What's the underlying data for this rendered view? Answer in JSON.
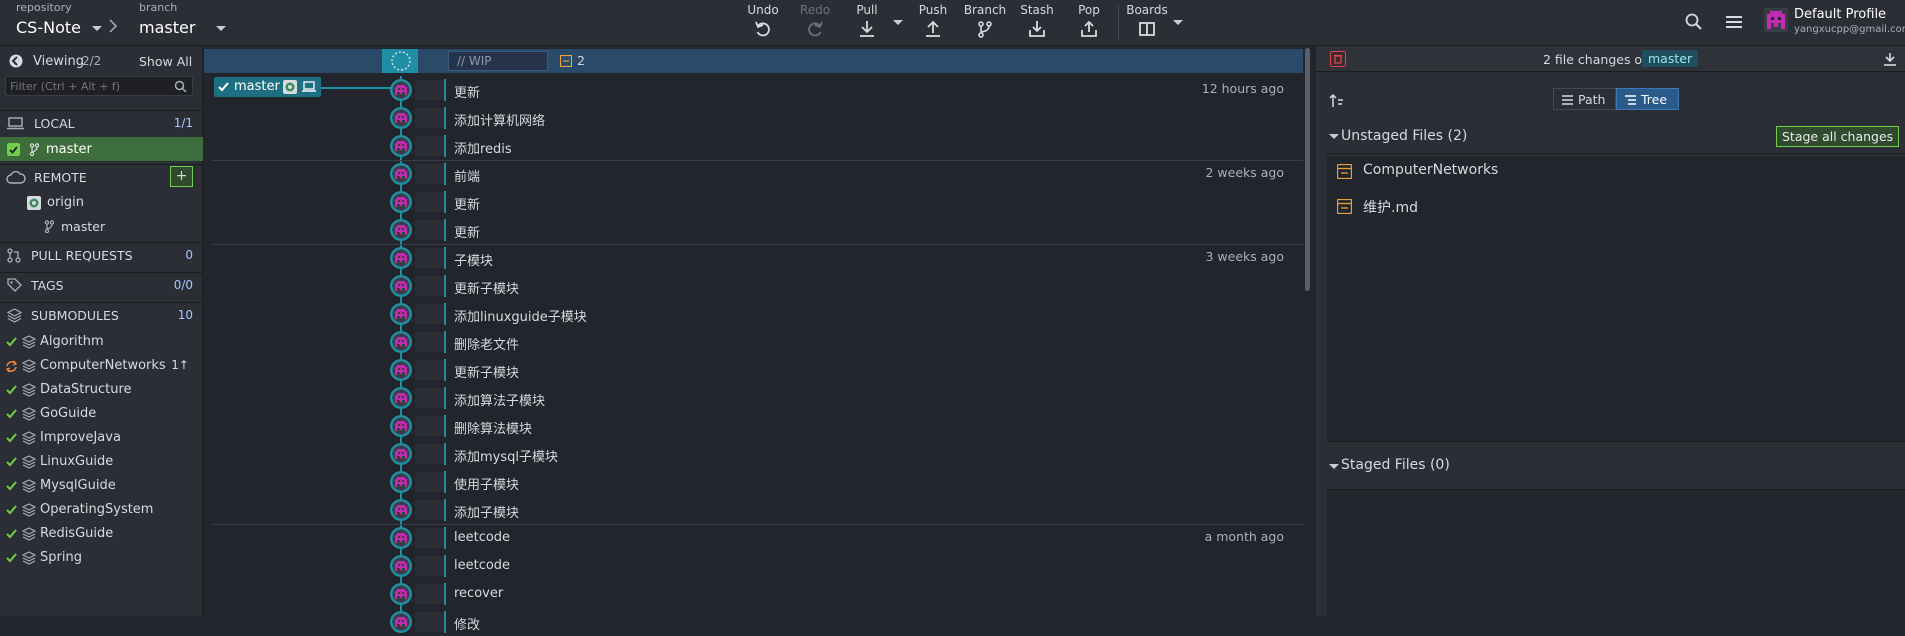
{
  "topbar": {
    "repo_label": "repository",
    "repo_name": "CS-Note",
    "branch_label": "branch",
    "branch_name": "master",
    "tools": [
      {
        "label": "Undo",
        "icon": "undo-icon"
      },
      {
        "label": "Redo",
        "icon": "redo-icon"
      },
      {
        "label": "Pull",
        "icon": "pull-icon"
      },
      {
        "label": "Push",
        "icon": "push-icon"
      },
      {
        "label": "Branch",
        "icon": "branch-icon"
      },
      {
        "label": "Stash",
        "icon": "stash-icon"
      },
      {
        "label": "Pop",
        "icon": "pop-icon"
      },
      {
        "label": "Boards",
        "icon": "boards-icon"
      }
    ],
    "profile_name": "Default Profile",
    "profile_email": "yangxucpp@gmail.com"
  },
  "left": {
    "viewing_label": "Viewing",
    "viewing_count": "2/2",
    "show_all": "Show All",
    "filter_placeholder": "Filter (Ctrl + Alt + f)",
    "local_label": "LOCAL",
    "local_count": "1/1",
    "local_branch": "master",
    "remote_label": "REMOTE",
    "remote_add": "+",
    "remote_origin": "origin",
    "remote_branch": "master",
    "pr_label": "PULL REQUESTS",
    "pr_count": "0",
    "tags_label": "TAGS",
    "tags_count": "0/0",
    "submodules_label": "SUBMODULES",
    "submodules_count": "10",
    "submodules": [
      {
        "name": "Algorithm",
        "badge": ""
      },
      {
        "name": "ComputerNetworks",
        "badge": "1↑"
      },
      {
        "name": "DataStructure",
        "badge": ""
      },
      {
        "name": "GoGuide",
        "badge": ""
      },
      {
        "name": "ImproveJava",
        "badge": ""
      },
      {
        "name": "LinuxGuide",
        "badge": ""
      },
      {
        "name": "MysqlGuide",
        "badge": ""
      },
      {
        "name": "OperatingSystem",
        "badge": ""
      },
      {
        "name": "RedisGuide",
        "badge": ""
      },
      {
        "name": "Spring",
        "badge": ""
      }
    ]
  },
  "graph": {
    "wip_placeholder": "// WIP",
    "wip_count": "2",
    "branch_tag": "master",
    "commits": [
      {
        "msg": "更新",
        "time": "12 hours ago"
      },
      {
        "msg": "添加计算机网络",
        "time": ""
      },
      {
        "msg": "添加redis",
        "time": ""
      },
      {
        "msg": "前端",
        "time": "2 weeks ago"
      },
      {
        "msg": "更新",
        "time": ""
      },
      {
        "msg": "更新",
        "time": ""
      },
      {
        "msg": "子模块",
        "time": "3 weeks ago"
      },
      {
        "msg": "更新子模块",
        "time": ""
      },
      {
        "msg": "添加linuxguide子模块",
        "time": ""
      },
      {
        "msg": "删除老文件",
        "time": ""
      },
      {
        "msg": "更新子模块",
        "time": ""
      },
      {
        "msg": "添加算法子模块",
        "time": ""
      },
      {
        "msg": "删除算法模块",
        "time": ""
      },
      {
        "msg": "添加mysql子模块",
        "time": ""
      },
      {
        "msg": "使用子模块",
        "time": ""
      },
      {
        "msg": "添加子模块",
        "time": ""
      },
      {
        "msg": "leetcode",
        "time": "a month ago"
      },
      {
        "msg": "leetcode",
        "time": ""
      },
      {
        "msg": "recover",
        "time": ""
      },
      {
        "msg": "修改",
        "time": ""
      }
    ]
  },
  "right": {
    "changes_text": "2 file changes on",
    "branch": "master",
    "path_label": "Path",
    "tree_label": "Tree",
    "unstaged_label": "Unstaged Files (2)",
    "stage_all": "Stage all changes",
    "unstaged_files": [
      "ComputerNetworks",
      "维护.md"
    ],
    "staged_label": "Staged Files (0)"
  },
  "colors": {
    "accent": "#1f8fa6",
    "green": "#6fcf4b",
    "selected_row": "#3d6d3a"
  }
}
